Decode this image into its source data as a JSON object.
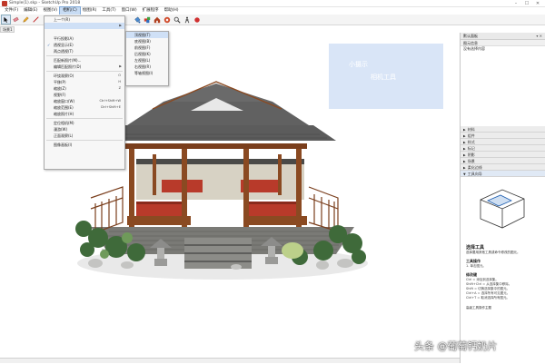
{
  "window": {
    "title": "Simple(1).skp - SketchUp Pro 2018",
    "controls": [
      "–",
      "☐",
      "✕"
    ]
  },
  "menubar": {
    "items": [
      "文件(F)",
      "编辑(E)",
      "视图(V)",
      "相机(C)",
      "绘图(R)",
      "工具(T)",
      "窗口(W)",
      "扩展程序",
      "帮助(H)"
    ],
    "active_index": 3
  },
  "toolbar": {
    "left_icons": [
      "select-icon",
      "eraser-icon",
      "pencil-icon",
      "line-icon"
    ],
    "right_icons": [
      "paint-bucket-icon",
      "component-icon",
      "warehouse-icon",
      "extension-warehouse-icon",
      "zoom-icon",
      "walk-icon",
      "dot-icon"
    ]
  },
  "scene_tab": {
    "label": "场景1"
  },
  "camera_menu": {
    "items": [
      {
        "label": "上一个(R)",
        "shortcut": "",
        "submenu": false,
        "checked": false,
        "highlighted": false
      },
      {
        "label": "",
        "shortcut": "",
        "submenu": true,
        "checked": false,
        "highlighted": true
      },
      {
        "label": "",
        "shortcut": "",
        "submenu": false,
        "checked": false,
        "highlighted": false
      },
      {
        "label": "平行投影(A)",
        "shortcut": "",
        "submenu": false,
        "checked": false,
        "highlighted": false
      },
      {
        "label": "透视显示(E)",
        "shortcut": "",
        "submenu": false,
        "checked": true,
        "highlighted": false
      },
      {
        "label": "两点透视(T)",
        "shortcut": "",
        "submenu": false,
        "checked": false,
        "highlighted": false
      },
      {
        "label": "",
        "divider": true
      },
      {
        "label": "匹配新照片(M)...",
        "shortcut": "",
        "submenu": false,
        "checked": false,
        "highlighted": false
      },
      {
        "label": "编辑匹配照片(D)",
        "shortcut": "",
        "submenu": true,
        "checked": false,
        "highlighted": false
      },
      {
        "label": "",
        "divider": true
      },
      {
        "label": "环绕观察(O)",
        "shortcut": "O",
        "submenu": false,
        "checked": false,
        "highlighted": false
      },
      {
        "label": "平移(P)",
        "shortcut": "H",
        "submenu": false,
        "checked": false,
        "highlighted": false
      },
      {
        "label": "缩放(Z)",
        "shortcut": "Z",
        "submenu": false,
        "checked": false,
        "highlighted": false
      },
      {
        "label": "视野(F)",
        "shortcut": "",
        "submenu": false,
        "checked": false,
        "highlighted": false
      },
      {
        "label": "缩放窗口(W)",
        "shortcut": "Ctrl+Shift+W",
        "submenu": false,
        "checked": false,
        "highlighted": false
      },
      {
        "label": "缩放范围(E)",
        "shortcut": "Ctrl+Shift+E",
        "submenu": false,
        "checked": false,
        "highlighted": false
      },
      {
        "label": "缩放照片(H)",
        "shortcut": "",
        "submenu": false,
        "checked": false,
        "highlighted": false
      },
      {
        "label": "",
        "divider": true
      },
      {
        "label": "定位相机(M)",
        "shortcut": "",
        "submenu": false,
        "checked": false,
        "highlighted": false
      },
      {
        "label": "漫游(W)",
        "shortcut": "",
        "submenu": false,
        "checked": false,
        "highlighted": false
      },
      {
        "label": "正面观察(L)",
        "shortcut": "",
        "submenu": false,
        "checked": false,
        "highlighted": false
      },
      {
        "label": "",
        "divider": true
      },
      {
        "label": "图像画板(I)",
        "shortcut": "",
        "submenu": false,
        "checked": false,
        "highlighted": false
      }
    ]
  },
  "standard_views_menu": {
    "items": [
      {
        "label": "顶视图(T)",
        "highlighted": true
      },
      {
        "label": "底视图(B)",
        "highlighted": false
      },
      {
        "label": "前视图(F)",
        "highlighted": false
      },
      {
        "label": "后视图(K)",
        "highlighted": false
      },
      {
        "label": "左视图(L)",
        "highlighted": false
      },
      {
        "label": "右视图(R)",
        "highlighted": false
      },
      {
        "label": "等轴视图(I)",
        "highlighted": false
      }
    ]
  },
  "viewport": {
    "overlay_line1": "小摄示",
    "overlay_line2": "相机工具",
    "overlay_color": "#d9e5f7"
  },
  "tray": {
    "header": "默认面板",
    "header_controls": "▾ ✕",
    "section": "图元信息",
    "section_sub": "没有选择内容",
    "panels": [
      "材料",
      "组件",
      "样式",
      "标记",
      "阴影",
      "场景",
      "柔化边线",
      "工具向导"
    ],
    "active_panel_index": 7,
    "instructor": {
      "title": "选择工具",
      "description": "选择要用其他工具或命令修改的图元。",
      "tool_ops_title": "工具操作",
      "tool_ops": [
        "1. 单击图元。"
      ],
      "modifier_title": "修改键",
      "modifier_lines": [
        "Ctrl = 添加到选择集。",
        "Shift+Ctrl = 从选择集中移除。",
        "Shift = 切换选择集中的图元。",
        "Ctrl+A = 选择所有可见图元。",
        "Ctrl+T = 取消选择所有图元。"
      ],
      "link": "高级工具操作主题"
    }
  },
  "statusbar": {
    "message": ""
  },
  "watermark": {
    "text": "头条 @葡萄钙奶片"
  },
  "colors": {
    "menu_highlight": "#cfe0f6",
    "roof": "#5c5c5c",
    "wood": "#8a4a22",
    "bench": "#b83a2a"
  }
}
